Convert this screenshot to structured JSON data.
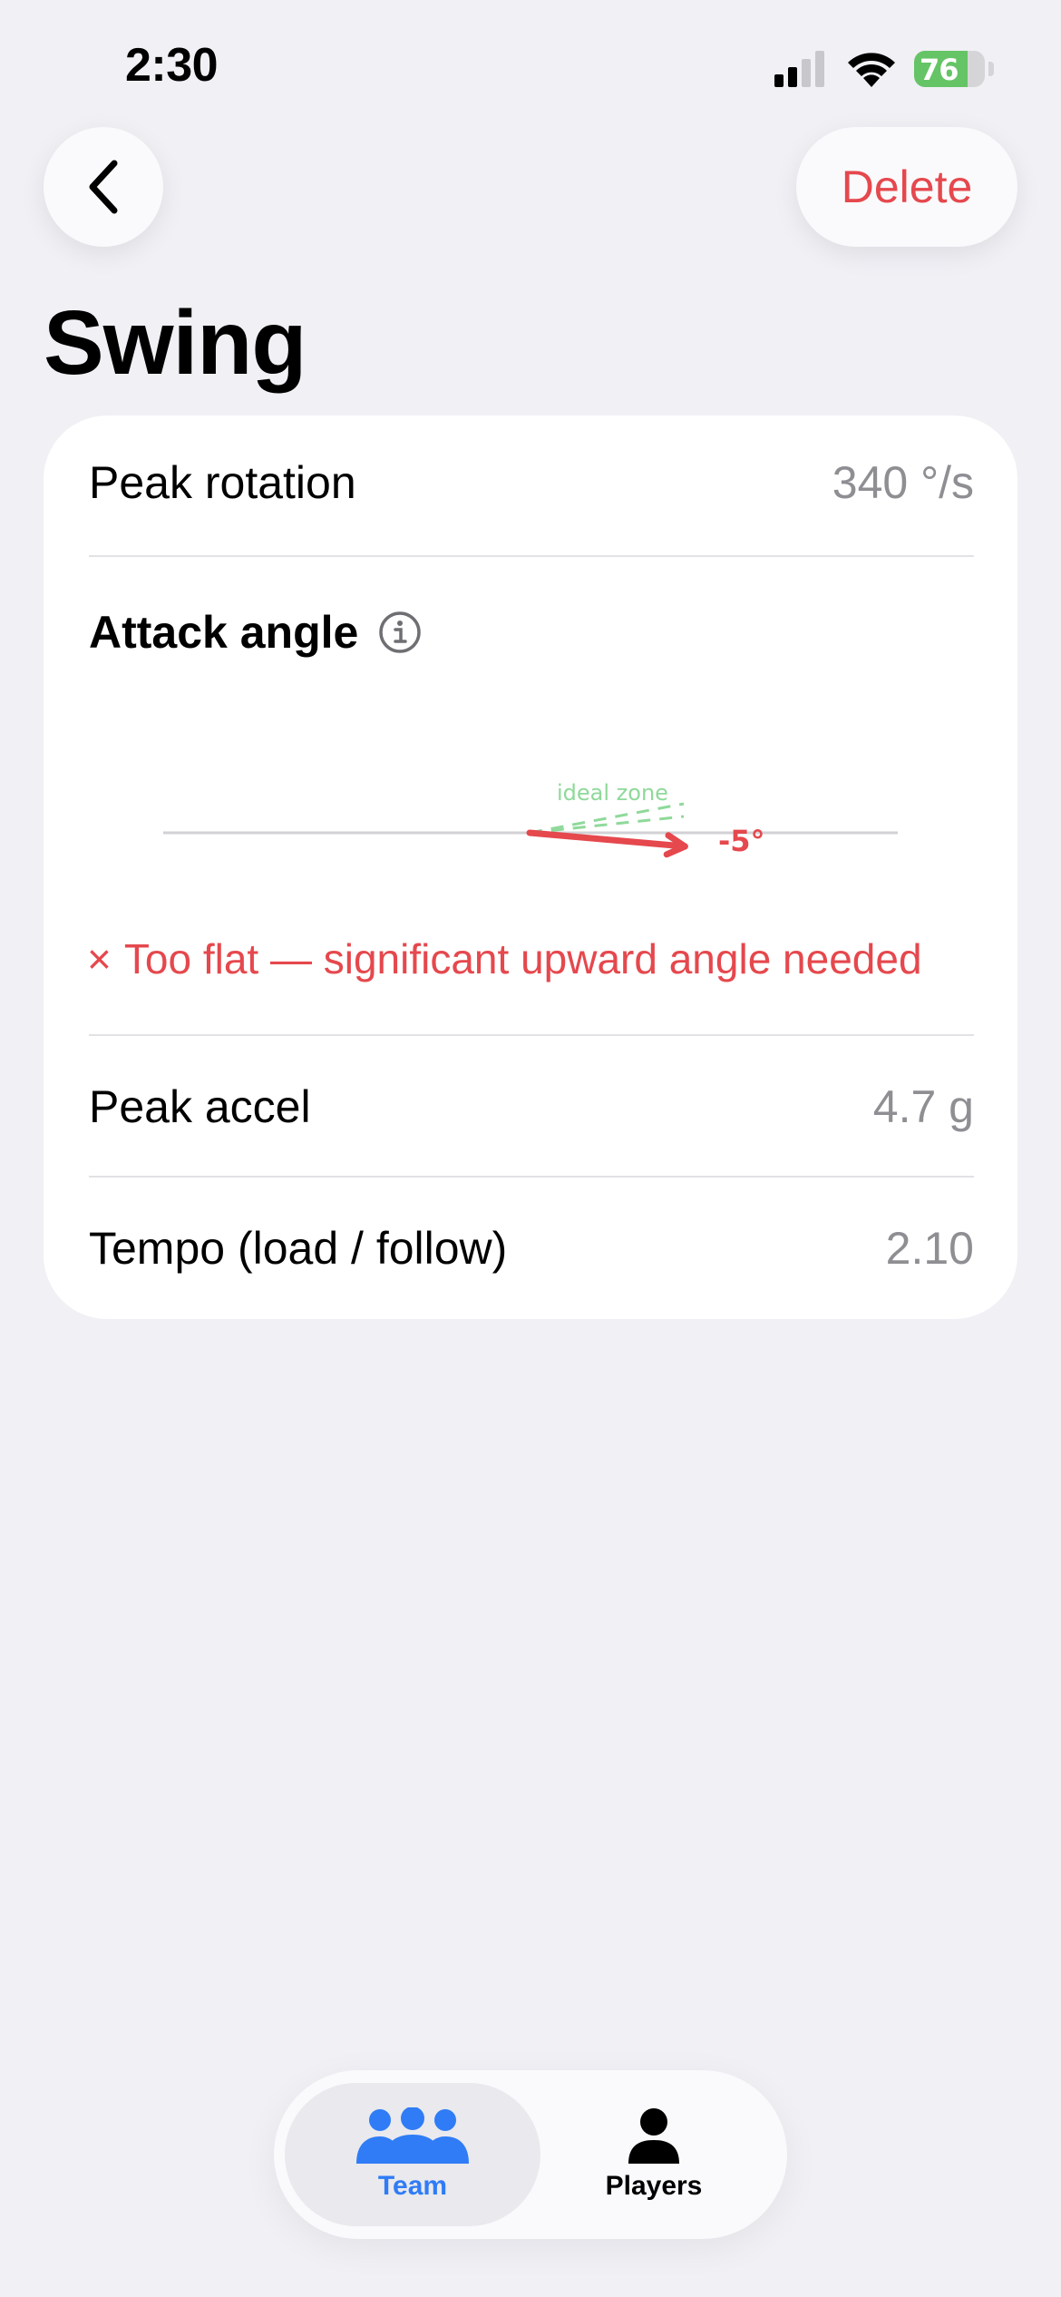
{
  "status_bar": {
    "time": "2:30",
    "battery_percent": "76",
    "battery_level": 0.76
  },
  "nav": {
    "delete_label": "Delete"
  },
  "page": {
    "title": "Swing"
  },
  "metrics": {
    "peak_rotation": {
      "label": "Peak rotation",
      "value": "340 °/s"
    },
    "attack_angle": {
      "label": "Attack angle",
      "angle_value": "-5°",
      "angle_degrees": -5,
      "ideal_zone_label": "ideal zone",
      "feedback_icon": "×",
      "feedback": "Too flat — significant upward angle needed"
    },
    "peak_accel": {
      "label": "Peak accel",
      "value": "4.7 g"
    },
    "tempo": {
      "label": "Tempo (load / follow)",
      "value": "2.10"
    }
  },
  "tabbar": {
    "tabs": [
      {
        "label": "Team",
        "icon": "team-icon",
        "active": true
      },
      {
        "label": "Players",
        "icon": "person-icon",
        "active": false
      }
    ]
  },
  "colors": {
    "accent": "#2f7cf6",
    "danger": "#e5484d",
    "ideal": "#34c759",
    "secondary_text": "#8e8e93"
  }
}
